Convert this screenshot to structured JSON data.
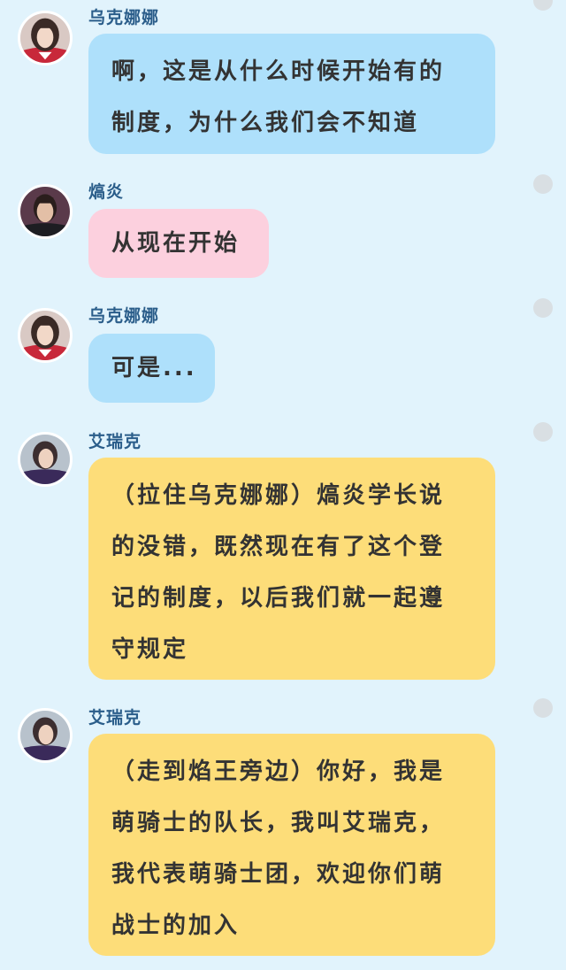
{
  "colors": {
    "background": "#e1f3fc",
    "bubble_blue": "#aee0fb",
    "bubble_pink": "#fcd0de",
    "bubble_yellow": "#fddd79",
    "name_text": "#2a5d8a",
    "message_text": "#333333"
  },
  "messages": [
    {
      "speaker": "乌克娜娜",
      "avatar": "girl-avatar",
      "bubble_color": "blue",
      "lines": [
        "啊，这是从什么时候开始有的",
        "制度，为什么我们会不知道"
      ]
    },
    {
      "speaker": "熇炎",
      "avatar": "man-avatar",
      "bubble_color": "pink",
      "lines": [
        "从现在开始"
      ]
    },
    {
      "speaker": "乌克娜娜",
      "avatar": "girl-avatar",
      "bubble_color": "blue",
      "lines": [
        "可是..."
      ]
    },
    {
      "speaker": "艾瑞克",
      "avatar": "boy-avatar",
      "bubble_color": "yellow",
      "lines": [
        "（拉住乌克娜娜）熇炎学长说",
        "的没错，既然现在有了这个登",
        "记的制度，以后我们就一起遵",
        "守规定"
      ]
    },
    {
      "speaker": "艾瑞克",
      "avatar": "boy-avatar",
      "bubble_color": "yellow",
      "lines": [
        "（走到焰王旁边）你好，我是",
        "萌骑士的队长，我叫艾瑞克，",
        "我代表萌骑士团，欢迎你们萌",
        "战士的加入"
      ]
    }
  ]
}
